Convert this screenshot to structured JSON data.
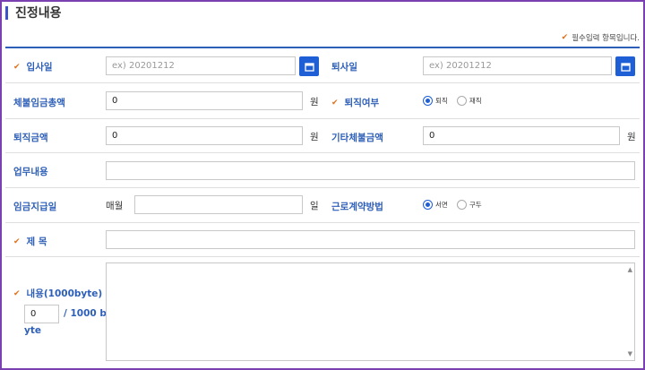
{
  "title": "진정내용",
  "required_note": "필수입력 항목입니다.",
  "fields": {
    "hire_date": {
      "label": "입사일",
      "placeholder": "ex) 20201212"
    },
    "leave_date": {
      "label": "퇴사일",
      "placeholder": "ex) 20201212"
    },
    "unpaid_total": {
      "label": "체불임금총액",
      "value": "0",
      "unit": "원"
    },
    "resigned": {
      "label": "퇴직여부",
      "options": [
        "퇴직",
        "재직"
      ],
      "selected": "퇴직"
    },
    "severance": {
      "label": "퇴직금액",
      "value": "0",
      "unit": "원"
    },
    "other_unpaid": {
      "label": "기타체불금액",
      "value": "0",
      "unit": "원"
    },
    "job_description": {
      "label": "업무내용",
      "value": ""
    },
    "pay_day": {
      "label": "임금지급일",
      "prefix": "매월",
      "value": "",
      "unit": "일"
    },
    "contract_method": {
      "label": "근로계약방법",
      "options": [
        "서면",
        "구두"
      ],
      "selected": "서면"
    },
    "subject": {
      "label": "제 목",
      "value": ""
    },
    "content": {
      "label": "내용(1000byte)",
      "byte_count": "0",
      "byte_limit_a": "/ 1000 b",
      "byte_limit_b": "yte"
    }
  },
  "icons": {
    "required": "checkmark-icon",
    "calendar": "calendar-icon"
  },
  "colors": {
    "accent": "#2d5fb8",
    "button": "#1f5fd6",
    "check": "#e0701a",
    "frame": "#7a3fb0"
  }
}
